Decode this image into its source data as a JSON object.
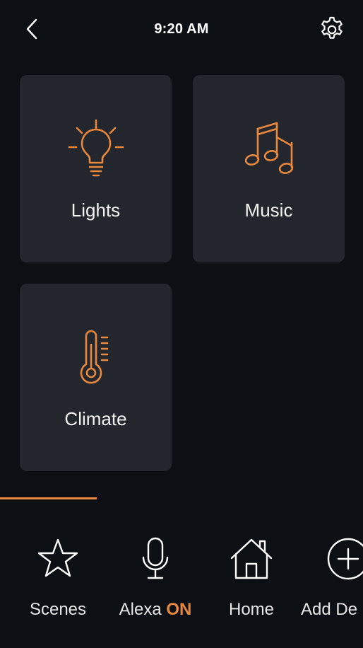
{
  "status_bar": {
    "time": "9:20 AM",
    "back_icon": "chevron-left-icon",
    "settings_icon": "gear-icon"
  },
  "tiles": [
    {
      "label": "Lights",
      "icon": "lightbulb-icon"
    },
    {
      "label": "Music",
      "icon": "music-notes-icon"
    },
    {
      "label": "Climate",
      "icon": "thermometer-icon"
    }
  ],
  "bottom_nav": {
    "items": [
      {
        "label": "Scenes",
        "icon": "star-icon"
      },
      {
        "label": "Alexa",
        "status": "ON",
        "icon": "microphone-icon"
      },
      {
        "label": "Home",
        "icon": "house-icon"
      },
      {
        "label": "Add De",
        "icon": "plus-circle-icon"
      }
    ]
  },
  "colors": {
    "background": "#0c0f14",
    "tile": "#23262c",
    "accent": "#e8883e",
    "text": "#ffffff"
  }
}
